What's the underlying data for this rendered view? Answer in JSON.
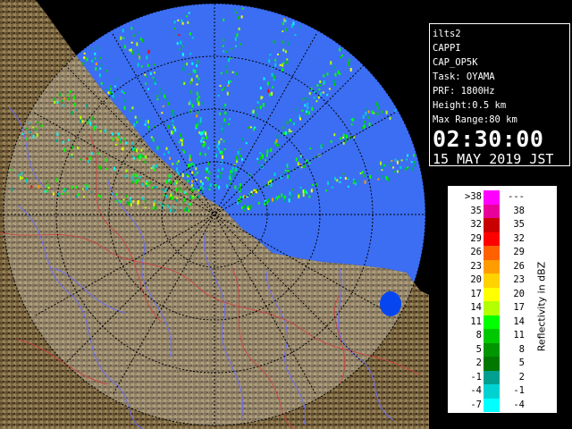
{
  "info": {
    "site": "ilts2",
    "product": "CAPPI",
    "config": "CAP_OP5K",
    "task": "Task: OYAMA",
    "prf": "PRF: 1800Hz",
    "height": "Height:0.5 km",
    "max_range": "Max Range:80 km",
    "time": "02:30:00",
    "date": "15 MAY 2019 JST"
  },
  "legend": {
    "unit_label": "Reflectivity in dBZ",
    "rows": [
      {
        "low": ">38",
        "high": "---",
        "color": "#ff00ff"
      },
      {
        "low": "35",
        "high": "38",
        "color": "#e8009a"
      },
      {
        "low": "32",
        "high": "35",
        "color": "#c80000"
      },
      {
        "low": "29",
        "high": "32",
        "color": "#ff0000"
      },
      {
        "low": "26",
        "high": "29",
        "color": "#ff6000"
      },
      {
        "low": "23",
        "high": "26",
        "color": "#ff9c00"
      },
      {
        "low": "20",
        "high": "23",
        "color": "#ffd200"
      },
      {
        "low": "17",
        "high": "20",
        "color": "#ffff00"
      },
      {
        "low": "14",
        "high": "17",
        "color": "#b4ff00"
      },
      {
        "low": "11",
        "high": "14",
        "color": "#00ff00"
      },
      {
        "low": "8",
        "high": "11",
        "color": "#00c800"
      },
      {
        "low": "5",
        "high": "8",
        "color": "#009600"
      },
      {
        "low": "2",
        "high": "5",
        "color": "#007800"
      },
      {
        "low": "-1",
        "high": "2",
        "color": "#00a090"
      },
      {
        "low": "-4",
        "high": "-1",
        "color": "#00d2d2"
      },
      {
        "low": "-7",
        "high": "-4",
        "color": "#00ffff"
      }
    ]
  },
  "colors": {
    "sea": "#0646f0",
    "sea_deep": "#0a2fd0",
    "land": "#7a6440",
    "background": "#000000"
  }
}
